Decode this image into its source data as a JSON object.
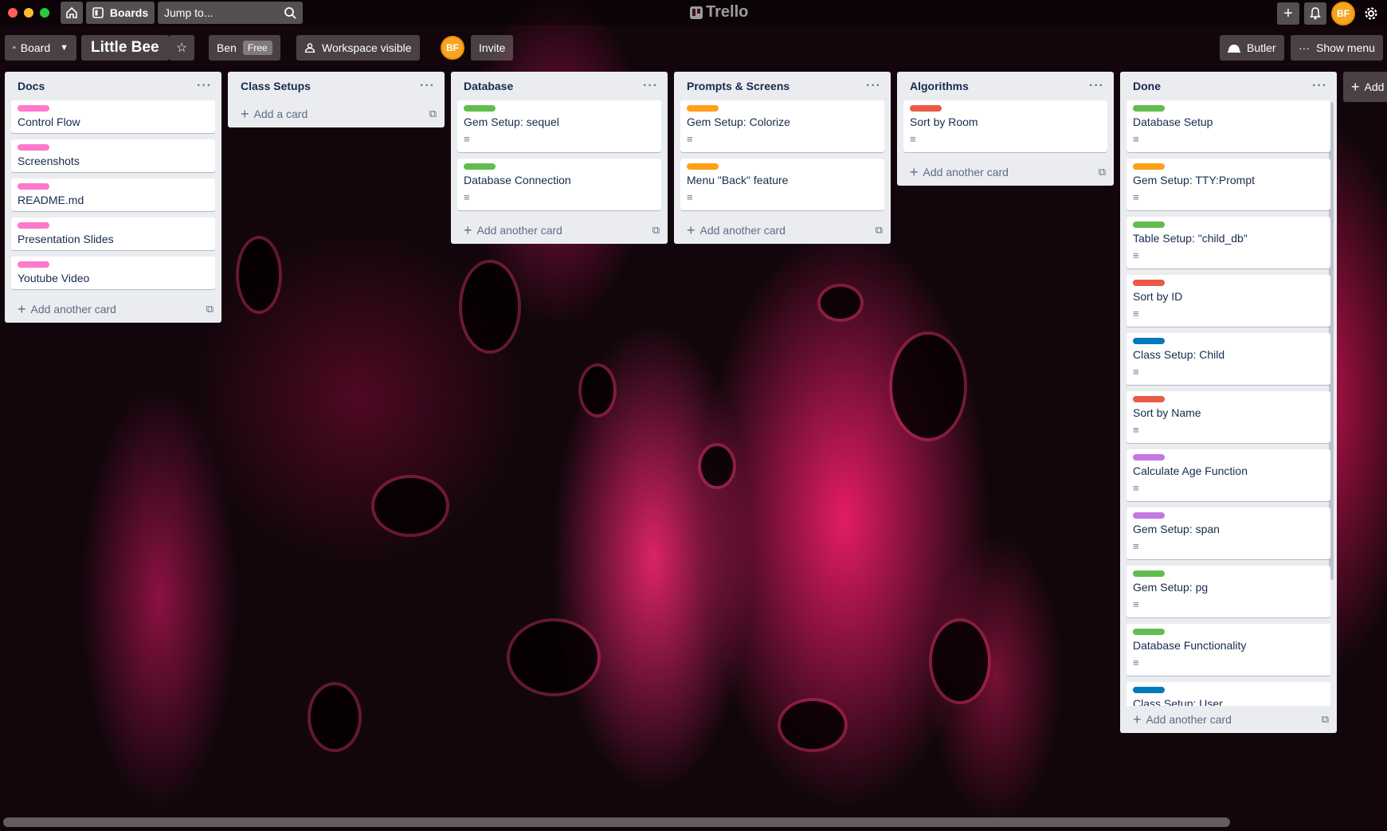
{
  "topbar": {
    "boards_label": "Boards",
    "jump_placeholder": "Jump to...",
    "logo": "Trello",
    "avatar": "BF"
  },
  "board": {
    "view_label": "Board",
    "title": "Little Bee",
    "workspace": "Ben",
    "plan": "Free",
    "visibility": "Workspace visible",
    "member_avatar": "BF",
    "invite_label": "Invite",
    "butler_label": "Butler",
    "menu_label": "Show menu",
    "add_list_label": "Add"
  },
  "colors": {
    "pink": "#ff78cb",
    "green": "#61bd4f",
    "orange": "#ff9f1a",
    "red": "#eb5a46",
    "blue": "#0079bf",
    "purple": "#c377e0"
  },
  "lists": [
    {
      "name": "Docs",
      "add_label": "Add another card",
      "cards": [
        {
          "title": "Control Flow",
          "label": "pink",
          "desc": false
        },
        {
          "title": "Screenshots",
          "label": "pink",
          "desc": false
        },
        {
          "title": "README.md",
          "label": "pink",
          "desc": false
        },
        {
          "title": "Presentation Slides",
          "label": "pink",
          "desc": false
        },
        {
          "title": "Youtube Video",
          "label": "pink",
          "desc": false
        }
      ]
    },
    {
      "name": "Class Setups",
      "add_label": "Add a card",
      "cards": []
    },
    {
      "name": "Database",
      "add_label": "Add another card",
      "cards": [
        {
          "title": "Gem Setup: sequel",
          "label": "green",
          "desc": true
        },
        {
          "title": "Database Connection",
          "label": "green",
          "desc": true
        }
      ]
    },
    {
      "name": "Prompts & Screens",
      "add_label": "Add another card",
      "cards": [
        {
          "title": "Gem Setup: Colorize",
          "label": "orange",
          "desc": true
        },
        {
          "title": "Menu \"Back\" feature",
          "label": "orange",
          "desc": true
        }
      ]
    },
    {
      "name": "Algorithms",
      "add_label": "Add another card",
      "cards": [
        {
          "title": "Sort by Room",
          "label": "red",
          "desc": true
        }
      ]
    },
    {
      "name": "Done",
      "add_label": "Add another card",
      "cards": [
        {
          "title": "Database Setup",
          "label": "green",
          "desc": true
        },
        {
          "title": "Gem Setup: TTY:Prompt",
          "label": "orange",
          "desc": true
        },
        {
          "title": "Table Setup: \"child_db\"",
          "label": "green",
          "desc": true
        },
        {
          "title": "Sort by ID",
          "label": "red",
          "desc": true
        },
        {
          "title": "Class Setup: Child",
          "label": "blue",
          "desc": true
        },
        {
          "title": "Sort by Name",
          "label": "red",
          "desc": true
        },
        {
          "title": "Calculate Age Function",
          "label": "purple",
          "desc": true
        },
        {
          "title": "Gem Setup: span",
          "label": "purple",
          "desc": true
        },
        {
          "title": "Gem Setup: pg",
          "label": "green",
          "desc": true
        },
        {
          "title": "Database Functionality",
          "label": "green",
          "desc": true
        },
        {
          "title": "Class Setup: User",
          "label": "blue",
          "desc": true
        }
      ]
    }
  ]
}
